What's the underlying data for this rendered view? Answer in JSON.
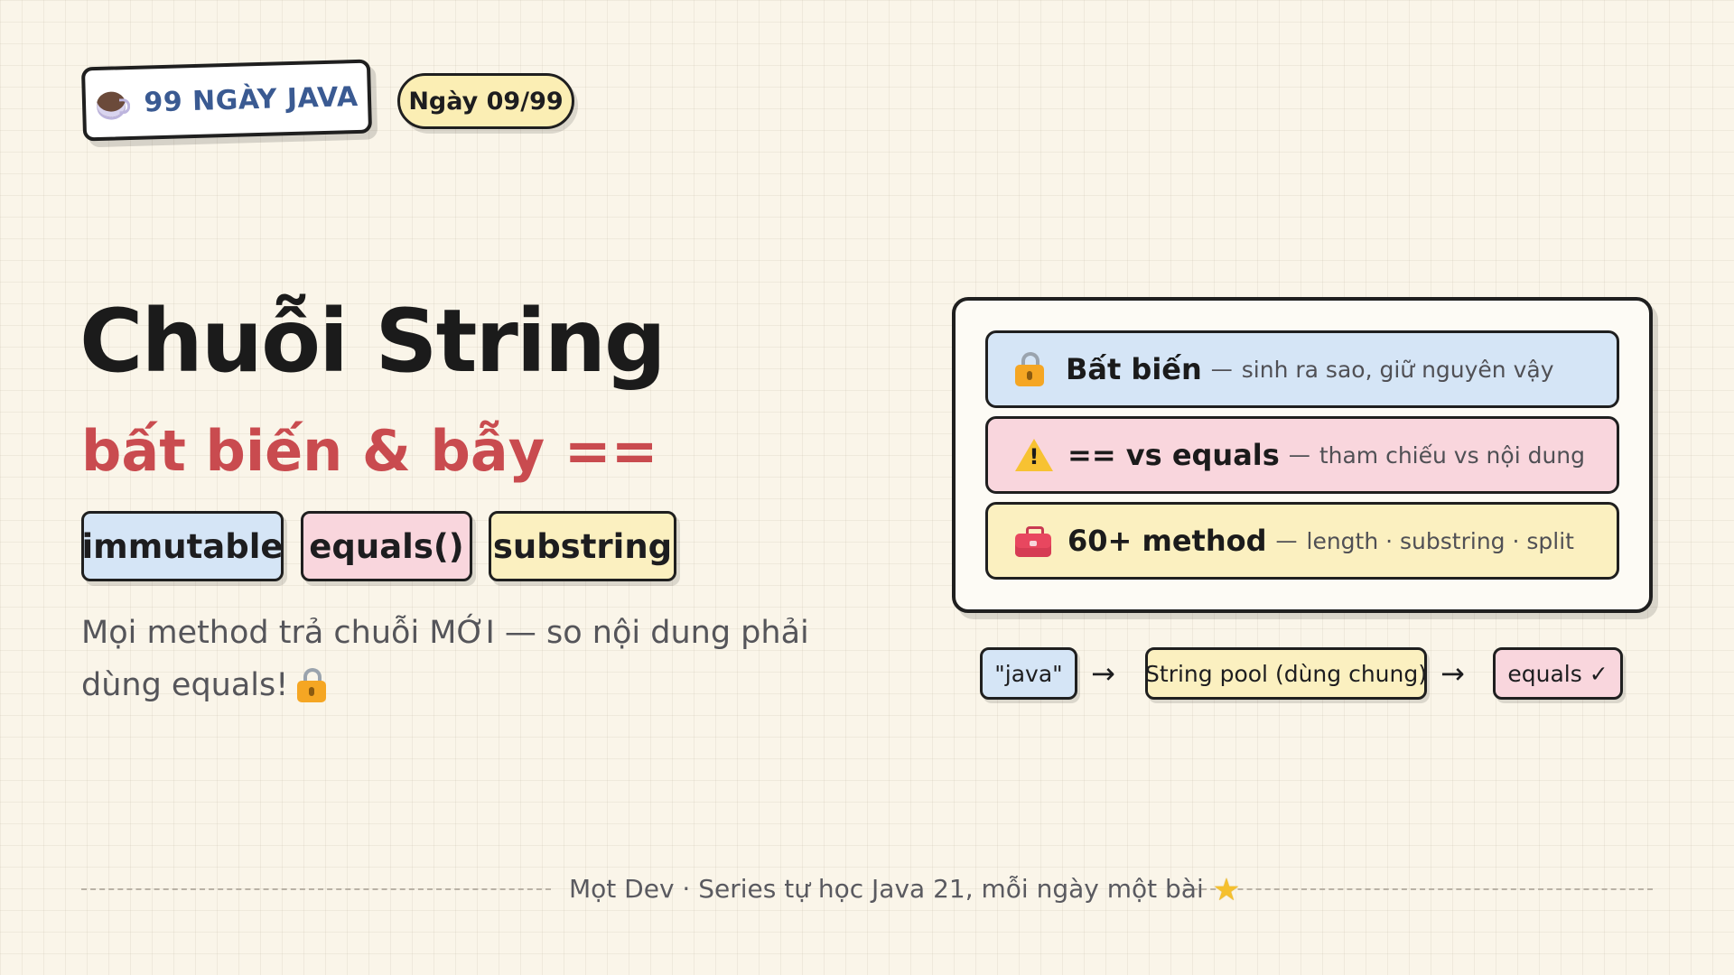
{
  "header": {
    "series_label": "99 NGÀY JAVA",
    "day_label": "Ngày 09/99",
    "series_icon": "coffee-cup-icon"
  },
  "hero": {
    "title": "Chuỗi String",
    "subtitle": "bất biến & bẫy ==",
    "tags": [
      "immutable",
      "equals()",
      "substring"
    ],
    "description": "Mọi method trả chuỗi MỚI — so nội dung phải dùng equals!"
  },
  "card": {
    "rows": [
      {
        "icon": "lock-icon",
        "title": "Bất biến",
        "dash": "—",
        "desc": "sinh ra sao, giữ nguyên vậy"
      },
      {
        "icon": "warning-icon",
        "title": "== vs equals",
        "dash": "—",
        "desc": "tham chiếu vs nội dung"
      },
      {
        "icon": "toolbox-icon",
        "title": "60+ method",
        "dash": "—",
        "desc": "length · substring · split"
      }
    ]
  },
  "flow": {
    "steps": [
      "\"java\"",
      "String pool (dùng chung)",
      "equals ✓"
    ],
    "arrow": "→"
  },
  "footer": {
    "text": "Mọt Dev · Series tự học Java 21, mỗi ngày một bài",
    "star": "★"
  },
  "colors": {
    "background": "#faf5e9",
    "accent_red": "#c94b4f",
    "series_blue": "#3a5a92",
    "blue_fill": "#d5e5f6",
    "pink_fill": "#f9d6dd",
    "yellow_fill": "#fbf0c0"
  }
}
